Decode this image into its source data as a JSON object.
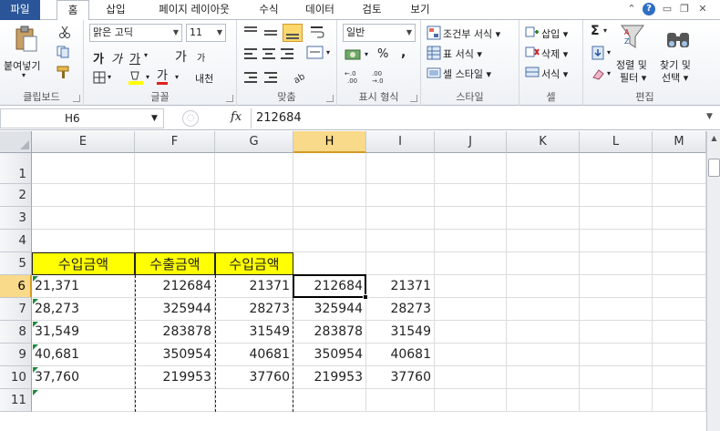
{
  "tabs": [
    {
      "label": "파일"
    },
    {
      "label": "홈"
    },
    {
      "label": "삽입"
    },
    {
      "label": "페이지 레이아웃"
    },
    {
      "label": "수식"
    },
    {
      "label": "데이터"
    },
    {
      "label": "검토"
    },
    {
      "label": "보기"
    }
  ],
  "ribbon": {
    "clipboard": {
      "paste": "붙여넣기",
      "label": "클립보드"
    },
    "font": {
      "name": "맑은 고딕",
      "size": "11",
      "label": "글꼴",
      "bold": "가",
      "italic": "가",
      "underline": "가",
      "grow": "가",
      "shrink": "가",
      "phonetic": "내천",
      "color": "가"
    },
    "alignment": {
      "label": "맞춤"
    },
    "number": {
      "format": "일반",
      "percent": "%",
      "comma": ",",
      "label": "표시 형식"
    },
    "styles": {
      "conditional": "조건부 서식",
      "table": "표 서식",
      "cell": "셀 스타일",
      "label": "스타일"
    },
    "cells": {
      "insert": "삽입",
      "delete": "삭제",
      "format": "서식",
      "label": "셀"
    },
    "editing": {
      "sort": "정렬 및",
      "sort2": "필터",
      "find": "찾기 및",
      "find2": "선택",
      "label": "편집",
      "sigma": "Σ"
    }
  },
  "formula_bar": {
    "name_box": "H6",
    "fx": "fx",
    "value": "212684"
  },
  "columns": [
    "E",
    "F",
    "G",
    "H",
    "I",
    "J",
    "K",
    "L",
    "M"
  ],
  "selected_column": "H",
  "rows": [
    {
      "num": "1",
      "cells": [
        "",
        "",
        "",
        "",
        ""
      ]
    },
    {
      "num": "2",
      "cells": [
        "",
        "",
        "",
        "",
        ""
      ]
    },
    {
      "num": "3",
      "cells": [
        "",
        "",
        "",
        "",
        ""
      ]
    },
    {
      "num": "4",
      "cells": [
        "",
        "",
        "",
        "",
        ""
      ]
    },
    {
      "num": "5",
      "cells": [
        "수입금액",
        "수출금액",
        "수입금액",
        "",
        ""
      ]
    },
    {
      "num": "6",
      "cells": [
        "21,371",
        "212684",
        "21371",
        "212684",
        "21371"
      ]
    },
    {
      "num": "7",
      "cells": [
        "28,273",
        "325944",
        "28273",
        "325944",
        "28273"
      ]
    },
    {
      "num": "8",
      "cells": [
        "31,549",
        "283878",
        "31549",
        "283878",
        "31549"
      ]
    },
    {
      "num": "9",
      "cells": [
        "40,681",
        "350954",
        "40681",
        "350954",
        "40681"
      ]
    },
    {
      "num": "10",
      "cells": [
        "37,760",
        "219953",
        "37760",
        "219953",
        "37760"
      ]
    },
    {
      "num": "11",
      "cells": [
        "",
        "",
        "",
        "",
        ""
      ]
    }
  ],
  "selected_row": "6",
  "colors": {
    "file_tab": "#2a5699",
    "header_fill": "#ffff00",
    "selection": "#f9d98a"
  }
}
